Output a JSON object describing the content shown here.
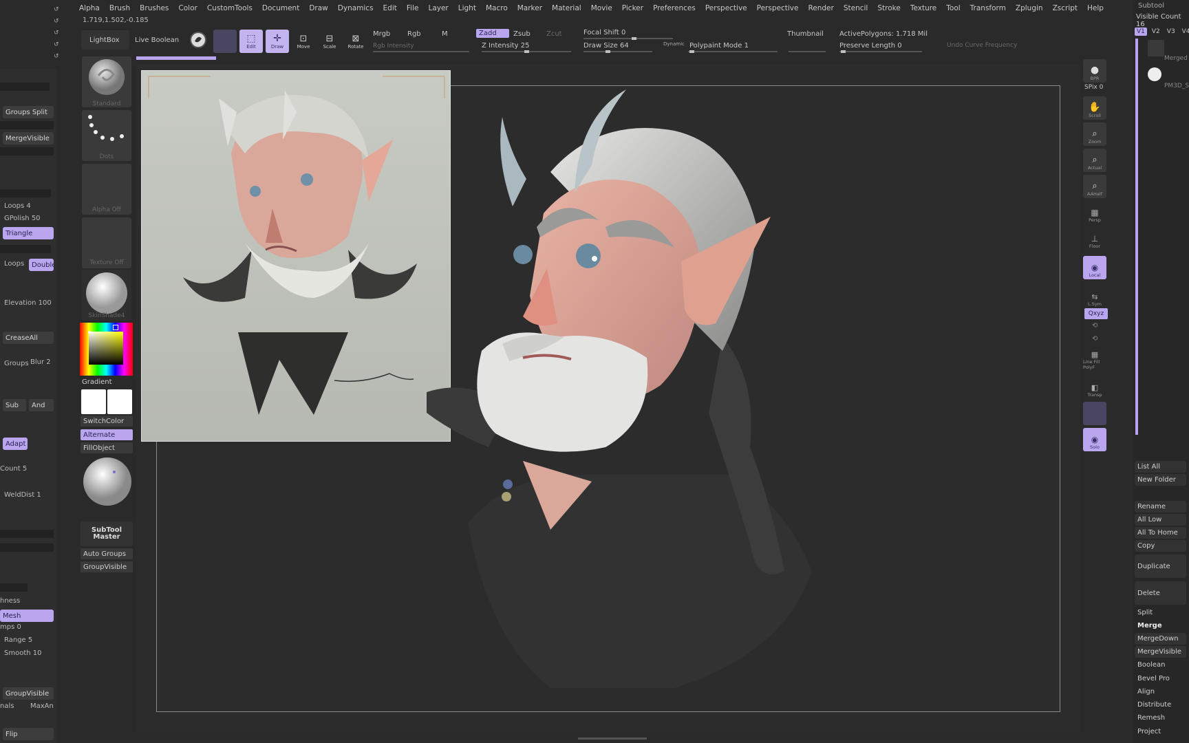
{
  "menu": [
    "Alpha",
    "Brush",
    "Brushes",
    "Color",
    "CustomTools",
    "Document",
    "Draw",
    "Dynamics",
    "Edit",
    "File",
    "Layer",
    "Light",
    "Macro",
    "Marker",
    "Material",
    "Movie",
    "Picker",
    "Preferences",
    "Perspective",
    "Perspective",
    "Render",
    "Stencil",
    "Stroke",
    "Texture",
    "Tool",
    "Transform",
    "Zplugin",
    "Zscript",
    "Help"
  ],
  "coords": "1.719,1.502,-0.185",
  "shelf": {
    "lightbox": "LightBox",
    "live_boolean": "Live Boolean",
    "edit": "Edit",
    "draw": "Draw",
    "move": "Move",
    "scale": "Scale",
    "rotate": "Rotate",
    "mrgb": "Mrgb",
    "rgb": "Rgb",
    "m": "M",
    "rgb_intensity": "Rgb Intensity",
    "zadd": "Zadd",
    "zsub": "Zsub",
    "zcut": "Zcut",
    "z_intensity": "Z Intensity 25",
    "focal_shift": "Focal Shift 0",
    "draw_size": "Draw Size 64",
    "dynamic": "Dynamic",
    "polypaint_mode": "Polypaint Mode 1",
    "thumbnail": "Thumbnail",
    "active_polygons": "ActivePolygons: 1.718 Mil",
    "preserve_length": "Preserve Length 0",
    "undo_label": "Undo Curve Frequency"
  },
  "left_panel": {
    "groups_split": "Groups Split",
    "merge_visible": "MergeVisible",
    "loops": "Loops 4",
    "gpolish": "GPolish 50",
    "triangle": "Triangle",
    "loops2": "Loops",
    "double": "Double",
    "elevation": "Elevation 100",
    "crease_all": "CreaseAll",
    "groups": "Groups",
    "blur": "Blur 2",
    "sub": "Sub",
    "and": "And",
    "adapt": "Adapt",
    "count": "Count 5",
    "welddist": "WeldDist 1",
    "hness": "hness",
    "mesh": "Mesh",
    "mps": "mps 0",
    "range": "Range 5",
    "smooth": "Smooth 10",
    "groupvisible": "GroupVisible",
    "nals": "nals",
    "maxang": "MaxAn",
    "flip": "Flip"
  },
  "palette": {
    "standard": "Standard",
    "dots": "Dots",
    "alpha_off": "Alpha Off",
    "texture_off": "Texture Off",
    "skinshade": "SkinShade4",
    "gradient": "Gradient",
    "switchcolor": "SwitchColor",
    "alternate": "Alternate",
    "fillobject": "FillObject",
    "subtool_master": "SubTool Master",
    "auto_groups": "Auto Groups",
    "group_visible": "GroupVisible"
  },
  "right_tools": [
    "BPR",
    "SPix 0",
    "Scroll",
    "Zoom",
    "Actual",
    "AAHalf",
    "Persp",
    "Floor",
    "Local",
    "L.Sym",
    "Qxyz",
    "",
    "",
    "Line Fill PolyF",
    "Transp",
    "",
    "Solo"
  ],
  "subtool": {
    "title": "Subtool",
    "visible_count": "Visible Count 16",
    "tabs": [
      "V1",
      "V2",
      "V3",
      "V4"
    ],
    "item1": "Merged",
    "item2": "PM3D_S",
    "buttons": [
      "List All",
      "New Folder",
      "Rename",
      "All Low",
      "All To Home",
      "Copy",
      "Duplicate",
      "Delete",
      "Split",
      "Merge",
      "MergeDown",
      "MergeVisible",
      "Boolean",
      "Bevel Pro",
      "Align",
      "Distribute",
      "Remesh",
      "Project"
    ]
  },
  "colors": {
    "accent": "#b9a6ef",
    "panel": "#2e2e2e",
    "canvas": "#2c2c2c"
  }
}
